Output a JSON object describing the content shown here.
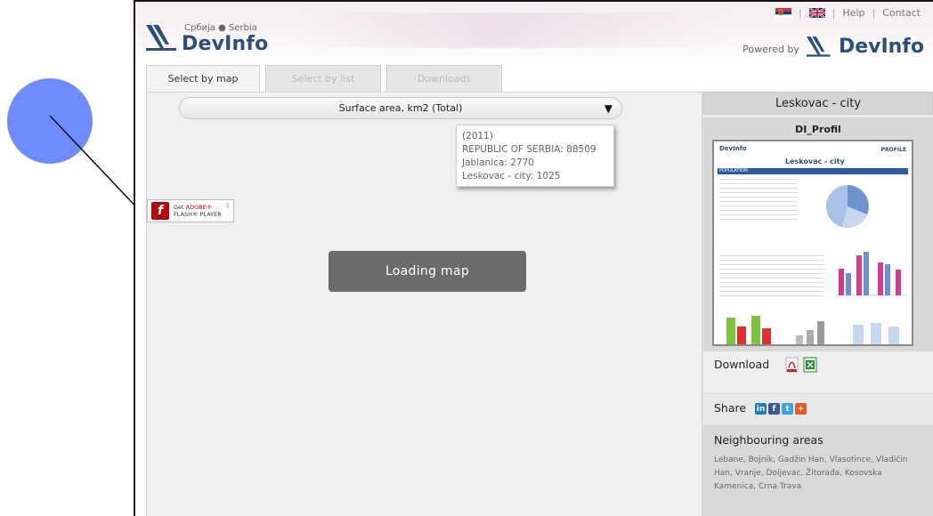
{
  "header": {
    "logo_subtitle": "Србија ● Serbia",
    "logo_word": "DevInfo",
    "top_links": {
      "help": "Help",
      "contact": "Contact",
      "separator": "|"
    },
    "powered_label": "Powered by",
    "powered_word": "DevInfo"
  },
  "tabs": [
    {
      "label": "Select by map",
      "active": true
    },
    {
      "label": "Select by list",
      "active": false
    },
    {
      "label": "Downloads",
      "active": false
    }
  ],
  "map": {
    "indicator_selected": "Surface area, km2 (Total)",
    "tooltip": {
      "year": "(2011)",
      "line1": "REPUBLIC OF SERBIA: 88509",
      "line2": "Jablanica: 2770",
      "line3": "Leskovac - city: 1025"
    },
    "flash_badge": {
      "get": "Get",
      "adobe": "ADOBE®",
      "product": "FLASH® PLAYER"
    },
    "loading_label": "Loading map"
  },
  "sidebar": {
    "area_title": "Leskovac - city",
    "profile_title": "DI_Profil",
    "thumb": {
      "brand": "DevInfo",
      "profile": "PROFILE",
      "city": "Leskovac - city",
      "section": "POPULATION"
    },
    "download_label": "Download",
    "share_label": "Share",
    "neighbours_title": "Neighbouring areas",
    "neighbours_list": "Lebane, Bojnik, Gadžin Han, Vlasotince, Vladičin Han, Vranje, Doljevac, Žitorađa, Kosovska Kamenica, Crna Trava"
  },
  "colors": {
    "brand_blue": "#2d4f7a",
    "overlay_circle": "#6f8cff",
    "loading_bg": "#6b6b6b"
  }
}
